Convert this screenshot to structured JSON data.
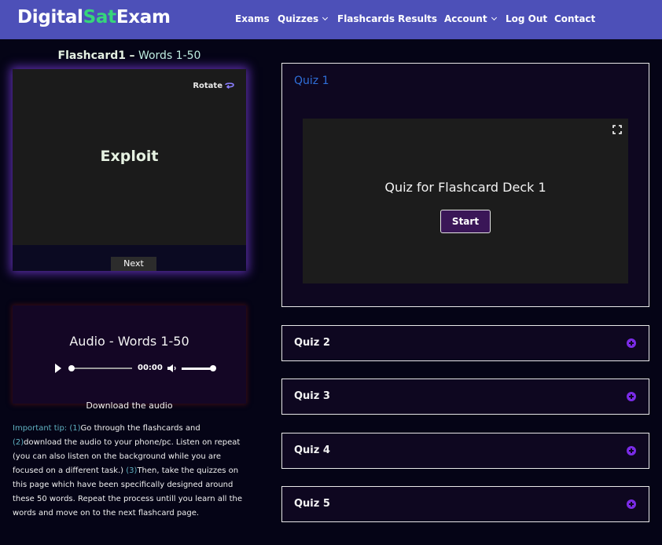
{
  "header": {
    "logo_part1": "Digital",
    "logo_part2": "Sat",
    "logo_part3": "Exam",
    "nav": [
      {
        "label": "Exams"
      },
      {
        "label": "Quizzes",
        "dropdown": true
      },
      {
        "label": "Flashcards"
      },
      {
        "label": "Results"
      },
      {
        "label": "Account",
        "dropdown": true
      },
      {
        "label": "Log Out"
      },
      {
        "label": "Contact"
      }
    ]
  },
  "flashcard": {
    "title": "Flashcard1",
    "dash": "–",
    "subtitle": "Words 1-50",
    "rotate_label": "Rotate",
    "word": "Exploit",
    "next_label": "Next"
  },
  "audio": {
    "title": "Audio - Words 1-50",
    "time": "00:00",
    "progress": 0,
    "volume": 1,
    "download_label": "Download the audio"
  },
  "tip": {
    "label": "Important tip:",
    "n1": "(1)",
    "t1": "Go through the flashcards and ",
    "n2": "(2)",
    "t2": "download the audio to your phone/pc. Listen on repeat (you can also listen on the background while you are focused on a different task.) ",
    "n3": "(3)",
    "t3": "Then, take the quizzes on this page which have been specifically designed around these 50 words. Repeat the process untill you learn all the words and move on to the next flashcard page."
  },
  "quizzes": {
    "quiz1_label": "Quiz 1",
    "stage_title": "Quiz for Flashcard Deck 1",
    "start_label": "Start",
    "rows": [
      {
        "label": "Quiz 2"
      },
      {
        "label": "Quiz 3"
      },
      {
        "label": "Quiz 4"
      },
      {
        "label": "Quiz 5"
      }
    ]
  },
  "colors": {
    "header_bg": "#4d50b8",
    "logo_accent": "#36d67a",
    "page_bg": "#050416",
    "accent_purple": "#7a2be6",
    "quiz1_link": "#2f6fd9",
    "tip_highlight": "#5fb1c1"
  },
  "icons": {
    "rotate": "rotate-icon",
    "play": "play-icon",
    "volume": "volume-icon",
    "fullscreen": "fullscreen-icon",
    "expand": "plus-circle-icon",
    "dropdown": "chevron-down-icon"
  }
}
